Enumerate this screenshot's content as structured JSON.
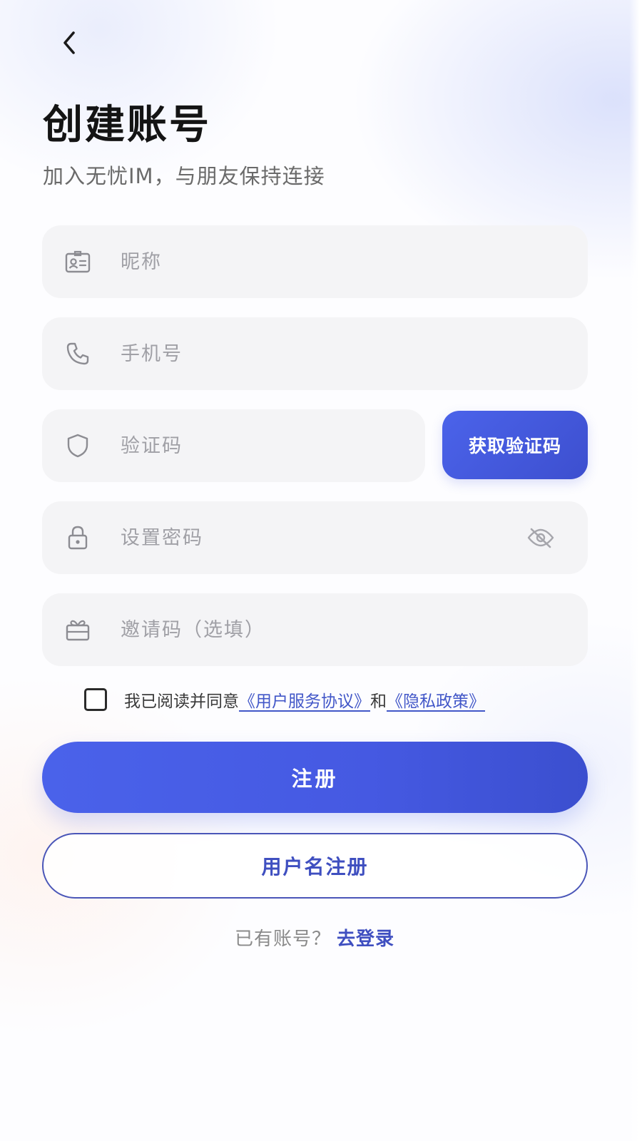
{
  "header": {
    "title": "创建账号",
    "subtitle": "加入无忧IM，与朋友保持连接"
  },
  "form": {
    "nickname": {
      "placeholder": "昵称",
      "icon": "id-card-icon"
    },
    "phone": {
      "placeholder": "手机号",
      "icon": "phone-icon"
    },
    "verification_code": {
      "placeholder": "验证码",
      "icon": "shield-icon"
    },
    "get_code_label": "获取验证码",
    "password": {
      "placeholder": "设置密码",
      "icon": "lock-icon",
      "visibility_icon": "eye-off-icon"
    },
    "invite_code": {
      "placeholder": "邀请码（选填）",
      "icon": "gift-icon"
    }
  },
  "agreement": {
    "checked": false,
    "prefix": "我已阅读并同意",
    "terms_link": "《用户服务协议》",
    "conjunction": "和",
    "privacy_link": "《隐私政策》"
  },
  "actions": {
    "register_label": "注册",
    "username_register_label": "用户名注册"
  },
  "footer": {
    "prompt": "已有账号？",
    "login_link": "去登录"
  },
  "colors": {
    "accent": "#4a62ea",
    "accent_dark": "#3b4fcf",
    "field_bg": "#f4f4f6",
    "link": "#4257c8"
  }
}
